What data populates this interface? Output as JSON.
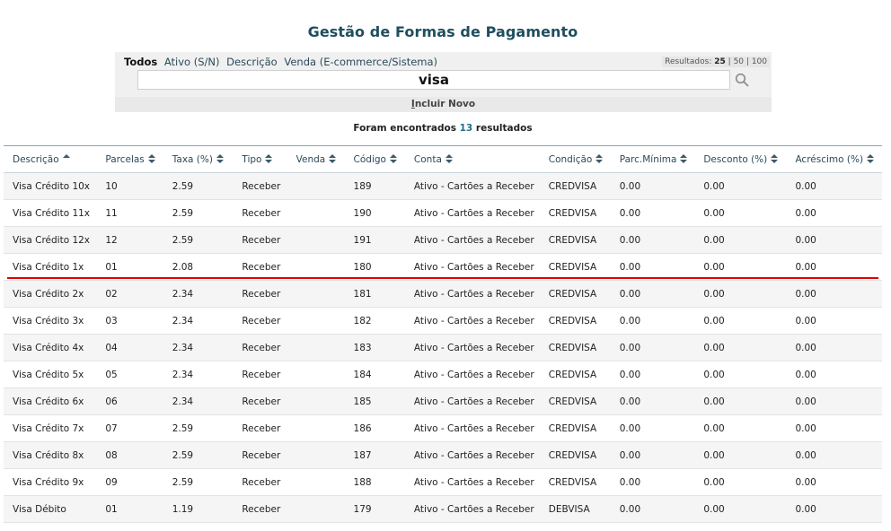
{
  "page": {
    "title": "Gestão de Formas de Pagamento"
  },
  "filters": {
    "items": [
      "Todos",
      "Ativo (S/N)",
      "Descrição",
      "Venda (E-commerce/Sistema)"
    ],
    "active": "Todos"
  },
  "pagination": {
    "label": "Resultados:",
    "options": [
      "25",
      "50",
      "100"
    ],
    "selected": "25",
    "sep": "|"
  },
  "search": {
    "value": "visa",
    "icon": "search-icon"
  },
  "actions": {
    "include_new_underlined": "I",
    "include_new_rest": "ncluir Novo"
  },
  "summary": {
    "prefix": "Foram encontrados",
    "count": "13",
    "suffix": "resultados"
  },
  "table": {
    "columns": [
      "Descrição",
      "Parcelas",
      "Taxa (%)",
      "Tipo",
      "Venda",
      "Código",
      "Conta",
      "Condição",
      "Parc.Mínima",
      "Desconto (%)",
      "Acréscimo (%)"
    ],
    "sort_icons": [
      "sort-asc-icon",
      "sort-both-icon",
      "sort-both-icon",
      "sort-both-icon",
      "sort-both-icon",
      "sort-both-icon",
      "sort-both-icon",
      "sort-both-icon",
      "sort-both-icon",
      "sort-both-icon",
      "sort-both-icon"
    ],
    "rows": [
      [
        "Visa Crédito 10x",
        "10",
        "2.59",
        "Receber",
        "",
        "189",
        "Ativo - Cartões a Receber",
        "CREDVISA",
        "0.00",
        "0.00",
        "0.00"
      ],
      [
        "Visa Crédito 11x",
        "11",
        "2.59",
        "Receber",
        "",
        "190",
        "Ativo - Cartões a Receber",
        "CREDVISA",
        "0.00",
        "0.00",
        "0.00"
      ],
      [
        "Visa Crédito 12x",
        "12",
        "2.59",
        "Receber",
        "",
        "191",
        "Ativo - Cartões a Receber",
        "CREDVISA",
        "0.00",
        "0.00",
        "0.00"
      ],
      [
        "Visa Crédito 1x",
        "01",
        "2.08",
        "Receber",
        "",
        "180",
        "Ativo - Cartões a Receber",
        "CREDVISA",
        "0.00",
        "0.00",
        "0.00"
      ],
      [
        "Visa Crédito 2x",
        "02",
        "2.34",
        "Receber",
        "",
        "181",
        "Ativo - Cartões a Receber",
        "CREDVISA",
        "0.00",
        "0.00",
        "0.00"
      ],
      [
        "Visa Crédito 3x",
        "03",
        "2.34",
        "Receber",
        "",
        "182",
        "Ativo - Cartões a Receber",
        "CREDVISA",
        "0.00",
        "0.00",
        "0.00"
      ],
      [
        "Visa Crédito 4x",
        "04",
        "2.34",
        "Receber",
        "",
        "183",
        "Ativo - Cartões a Receber",
        "CREDVISA",
        "0.00",
        "0.00",
        "0.00"
      ],
      [
        "Visa Crédito 5x",
        "05",
        "2.34",
        "Receber",
        "",
        "184",
        "Ativo - Cartões a Receber",
        "CREDVISA",
        "0.00",
        "0.00",
        "0.00"
      ],
      [
        "Visa Crédito 6x",
        "06",
        "2.34",
        "Receber",
        "",
        "185",
        "Ativo - Cartões a Receber",
        "CREDVISA",
        "0.00",
        "0.00",
        "0.00"
      ],
      [
        "Visa Crédito 7x",
        "07",
        "2.59",
        "Receber",
        "",
        "186",
        "Ativo - Cartões a Receber",
        "CREDVISA",
        "0.00",
        "0.00",
        "0.00"
      ],
      [
        "Visa Crédito 8x",
        "08",
        "2.59",
        "Receber",
        "",
        "187",
        "Ativo - Cartões a Receber",
        "CREDVISA",
        "0.00",
        "0.00",
        "0.00"
      ],
      [
        "Visa Crédito 9x",
        "09",
        "2.59",
        "Receber",
        "",
        "188",
        "Ativo - Cartões a Receber",
        "CREDVISA",
        "0.00",
        "0.00",
        "0.00"
      ],
      [
        "Visa Débito",
        "01",
        "1.19",
        "Receber",
        "",
        "179",
        "Ativo - Cartões a Receber",
        "DEBVISA",
        "0.00",
        "0.00",
        "0.00"
      ]
    ]
  },
  "colors": {
    "title": "#1f4e5f",
    "annotation_line": "#e00000",
    "header_border": "#7aa7bd"
  }
}
